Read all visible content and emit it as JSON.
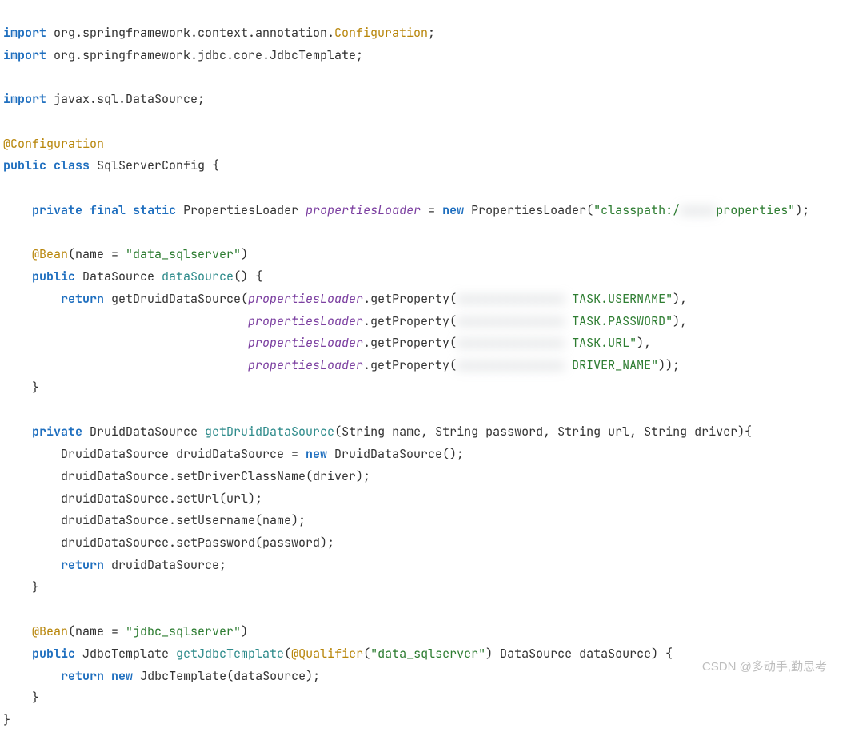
{
  "t": {
    "kw_import": "import",
    "kw_public": "public",
    "kw_class": "class",
    "kw_private": "private",
    "kw_final": "final",
    "kw_static": "static",
    "kw_new": "new",
    "kw_return": "return",
    "pkg_conf": " org.springframework.context.annotation.",
    "cls_conf": "Configuration",
    "semi": ";",
    "pkg_jdbc": " org.springframework.jdbc.core.JdbcTemplate;",
    "pkg_ds": " javax.sql.DataSource;",
    "ann_conf": "@Configuration",
    "class_decl": " SqlServerConfig {",
    "pl_type": " PropertiesLoader ",
    "pl_var": "propertiesLoader",
    "eq": " = ",
    "pl_ctor": " PropertiesLoader(",
    "str_classpath": "\"classpath:/",
    "blur1": "xxxxx",
    "str_props_end": "properties\"",
    "rparen_semi": ");",
    "ann_bean1": "@Bean",
    "bean1_args": "(name = ",
    "bean1_str": "\"data_sqlserver\"",
    "rparen": ")",
    "ds_type": " DataSource ",
    "m_dataSource": "dataSource",
    "empty_call": "() {",
    "call_getDruid": " getDruidDataSource(",
    "dot_getProp_open": ".getProperty(",
    "blur_long": "xxxxxxxxxxxxxxx",
    "str_task_user": "TASK.USERNAME\"",
    "rparen_comma": "),",
    "str_task_pass": "TASK.PASSWORD\"",
    "str_task_url": "TASK.URL\"",
    "str_driver": "DRIVER_NAME\"",
    "dbl_rparen_semi": "));",
    "brace_close": "}",
    "dds_type": " DruidDataSource ",
    "m_getDruid": "getDruidDataSource",
    "dds_params": "(String name, String password, String url, String driver){",
    "dds_decl": "DruidDataSource druidDataSource = ",
    "dds_ctor": " DruidDataSource();",
    "dds_setDriver": "druidDataSource.setDriverClassName(driver);",
    "dds_setUrl": "druidDataSource.setUrl(url);",
    "dds_setUser": "druidDataSource.setUsername(name);",
    "dds_setPass": "druidDataSource.setPassword(password);",
    "ret_dds": " druidDataSource;",
    "bean2_str": "\"jdbc_sqlserver\"",
    "jt_type": " JdbcTemplate ",
    "m_getJT": "getJdbcTemplate",
    "jt_open": "(",
    "ann_qual": "@Qualifier",
    "qual_open": "(",
    "jt_params_rest": " DataSource dataSource) {",
    "ret_jt_new": " JdbcTemplate(dataSource);",
    "watermark": "CSDN @多动手,勤思考"
  }
}
